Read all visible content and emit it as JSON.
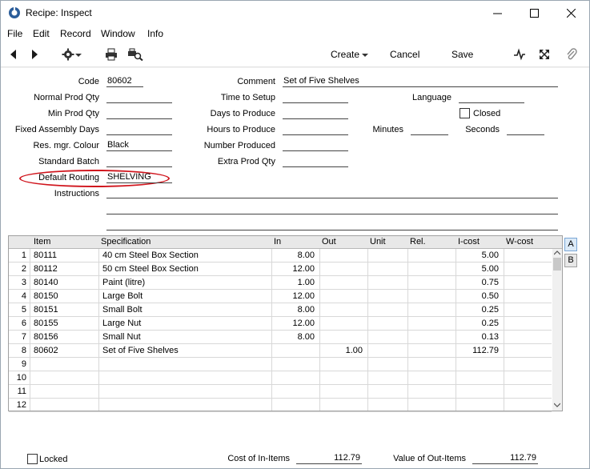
{
  "window": {
    "title": "Recipe: Inspect",
    "minimize_icon": "minimize-icon",
    "maximize_icon": "maximize-icon",
    "close_icon": "close-icon"
  },
  "menu": [
    "File",
    "Edit",
    "Record",
    "Window",
    "Info"
  ],
  "toolbar": {
    "create_label": "Create",
    "cancel_label": "Cancel",
    "save_label": "Save"
  },
  "form": {
    "code_label": "Code",
    "code_value": "80602",
    "normal_prod_qty_label": "Normal Prod Qty",
    "normal_prod_qty_value": "",
    "min_prod_qty_label": "Min Prod Qty",
    "min_prod_qty_value": "",
    "fixed_assembly_days_label": "Fixed Assembly Days",
    "fixed_assembly_days_value": "",
    "res_mgr_colour_label": "Res. mgr. Colour",
    "res_mgr_colour_value": "Black",
    "standard_batch_label": "Standard Batch",
    "standard_batch_value": "",
    "default_routing_label": "Default Routing",
    "default_routing_value": "SHELVING",
    "instructions_label": "Instructions",
    "comment_label": "Comment",
    "comment_value": "Set of Five Shelves",
    "time_to_setup_label": "Time to Setup",
    "time_to_setup_value": "",
    "days_to_produce_label": "Days to Produce",
    "days_to_produce_value": "",
    "hours_to_produce_label": "Hours to Produce",
    "hours_to_produce_value": "",
    "number_produced_label": "Number Produced",
    "number_produced_value": "",
    "extra_prod_qty_label": "Extra Prod Qty",
    "extra_prod_qty_value": "",
    "language_label": "Language",
    "language_value": "",
    "closed_label": "Closed",
    "minutes_label": "Minutes",
    "minutes_value": "",
    "seconds_label": "Seconds",
    "seconds_value": ""
  },
  "grid": {
    "columns": [
      "Item",
      "Specification",
      "In",
      "Out",
      "Unit",
      "Rel.",
      "I-cost",
      "W-cost"
    ],
    "rows": [
      {
        "n": "1",
        "item": "80111",
        "spec": "40 cm Steel Box Section",
        "in": "8.00",
        "out": "",
        "unit": "",
        "rel": "",
        "icost": "5.00",
        "wcost": ""
      },
      {
        "n": "2",
        "item": "80112",
        "spec": "50 cm Steel Box Section",
        "in": "12.00",
        "out": "",
        "unit": "",
        "rel": "",
        "icost": "5.00",
        "wcost": ""
      },
      {
        "n": "3",
        "item": "80140",
        "spec": "Paint (litre)",
        "in": "1.00",
        "out": "",
        "unit": "",
        "rel": "",
        "icost": "0.75",
        "wcost": ""
      },
      {
        "n": "4",
        "item": "80150",
        "spec": "Large Bolt",
        "in": "12.00",
        "out": "",
        "unit": "",
        "rel": "",
        "icost": "0.50",
        "wcost": ""
      },
      {
        "n": "5",
        "item": "80151",
        "spec": "Small Bolt",
        "in": "8.00",
        "out": "",
        "unit": "",
        "rel": "",
        "icost": "0.25",
        "wcost": ""
      },
      {
        "n": "6",
        "item": "80155",
        "spec": "Large Nut",
        "in": "12.00",
        "out": "",
        "unit": "",
        "rel": "",
        "icost": "0.25",
        "wcost": ""
      },
      {
        "n": "7",
        "item": "80156",
        "spec": "Small Nut",
        "in": "8.00",
        "out": "",
        "unit": "",
        "rel": "",
        "icost": "0.13",
        "wcost": ""
      },
      {
        "n": "8",
        "item": "80602",
        "spec": "Set of Five Shelves",
        "in": "",
        "out": "1.00",
        "unit": "",
        "rel": "",
        "icost": "112.79",
        "wcost": ""
      },
      {
        "n": "9",
        "item": "",
        "spec": "",
        "in": "",
        "out": "",
        "unit": "",
        "rel": "",
        "icost": "",
        "wcost": ""
      },
      {
        "n": "10",
        "item": "",
        "spec": "",
        "in": "",
        "out": "",
        "unit": "",
        "rel": "",
        "icost": "",
        "wcost": ""
      },
      {
        "n": "11",
        "item": "",
        "spec": "",
        "in": "",
        "out": "",
        "unit": "",
        "rel": "",
        "icost": "",
        "wcost": ""
      },
      {
        "n": "12",
        "item": "",
        "spec": "",
        "in": "",
        "out": "",
        "unit": "",
        "rel": "",
        "icost": "",
        "wcost": ""
      }
    ],
    "tab_a": "A",
    "tab_b": "B"
  },
  "footer": {
    "locked_label": "Locked",
    "cost_in_items_label": "Cost of In-Items",
    "cost_in_items_value": "112.79",
    "value_out_items_label": "Value of Out-Items",
    "value_out_items_value": "112.79"
  },
  "colors": {
    "highlight_ellipse": "#d0141c",
    "active_tab": "#dceaf7"
  }
}
